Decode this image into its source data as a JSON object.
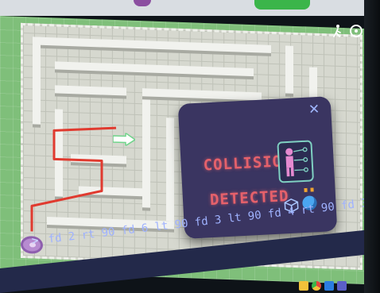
{
  "modal": {
    "title_line1": "COLLISION",
    "title_line2": "DETECTED",
    "close_glyph": "✕",
    "icons": [
      "scanner-icon",
      "block-icon",
      "robot-icon"
    ]
  },
  "command_bar": {
    "prompt": ">",
    "commands": "fd 2 rt 90 fd 6 lt 90 fd 3 lt 90 fd 4 rt 90 fd 3 rt 90 fd 6"
  },
  "top_icons": [
    "walker-icon",
    "target-icon"
  ],
  "colors": {
    "path": "#e03a2f",
    "alert_text": "#e5616b",
    "modal_bg": "#3a3561",
    "grass": "#7fbf7a",
    "floor": "#d6d8cf",
    "command_bar": "#23294a"
  },
  "taskbar_icons": [
    "folder-icon",
    "chrome-icon",
    "store-icon",
    "teams-icon"
  ]
}
